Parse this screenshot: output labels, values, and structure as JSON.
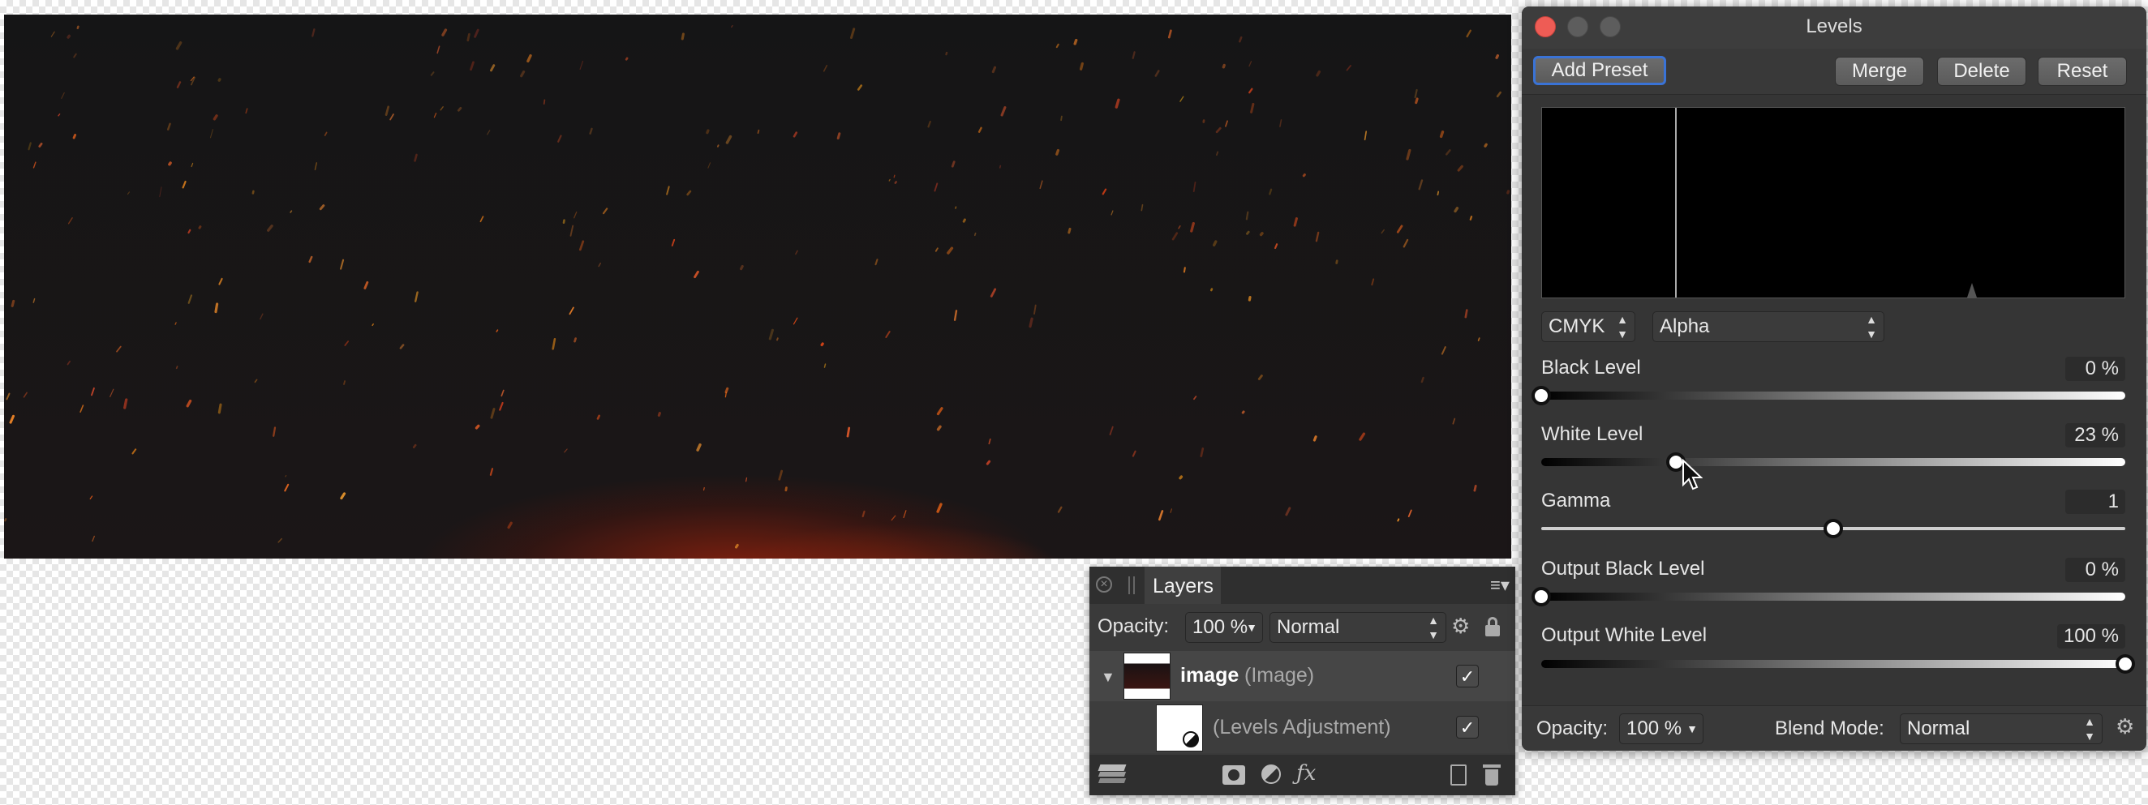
{
  "levels_panel": {
    "title": "Levels",
    "toolbar": {
      "add_preset": "Add Preset",
      "merge": "Merge",
      "delete": "Delete",
      "reset": "Reset"
    },
    "colour_space": "CMYK",
    "channel": "Alpha",
    "controls": {
      "black_level": {
        "label": "Black Level",
        "value": "0 %",
        "position": 0
      },
      "white_level": {
        "label": "White Level",
        "value": "23 %",
        "position": 0.23
      },
      "gamma": {
        "label": "Gamma",
        "value": "1",
        "position": 0.5
      },
      "output_black_level": {
        "label": "Output Black Level",
        "value": "0 %",
        "position": 0
      },
      "output_white_level": {
        "label": "Output White Level",
        "value": "100 %",
        "position": 1.0
      }
    },
    "footer": {
      "opacity_label": "Opacity:",
      "opacity_value": "100 %",
      "blend_mode_label": "Blend Mode:",
      "blend_mode_value": "Normal"
    }
  },
  "layers_panel": {
    "tab": "Layers",
    "opacity_label": "Opacity:",
    "opacity_value": "100 %",
    "blend_mode": "Normal",
    "layers": [
      {
        "name": "image",
        "type": "(Image)"
      },
      {
        "name": "",
        "type": "(Levels Adjustment)"
      }
    ]
  },
  "colors": {
    "accent_focus": "#3a73d6",
    "close_button": "#ee5c55",
    "panel_bg": "#353535"
  },
  "icons": [
    "close-icon",
    "minimize-icon",
    "zoom-icon",
    "gear-icon",
    "lock-icon",
    "menu-icon",
    "layers-icon",
    "mask-icon",
    "adjustment-icon",
    "fx-icon",
    "new-document-icon",
    "trash-icon",
    "disclosure-triangle-icon",
    "mouse-pointer-icon"
  ]
}
